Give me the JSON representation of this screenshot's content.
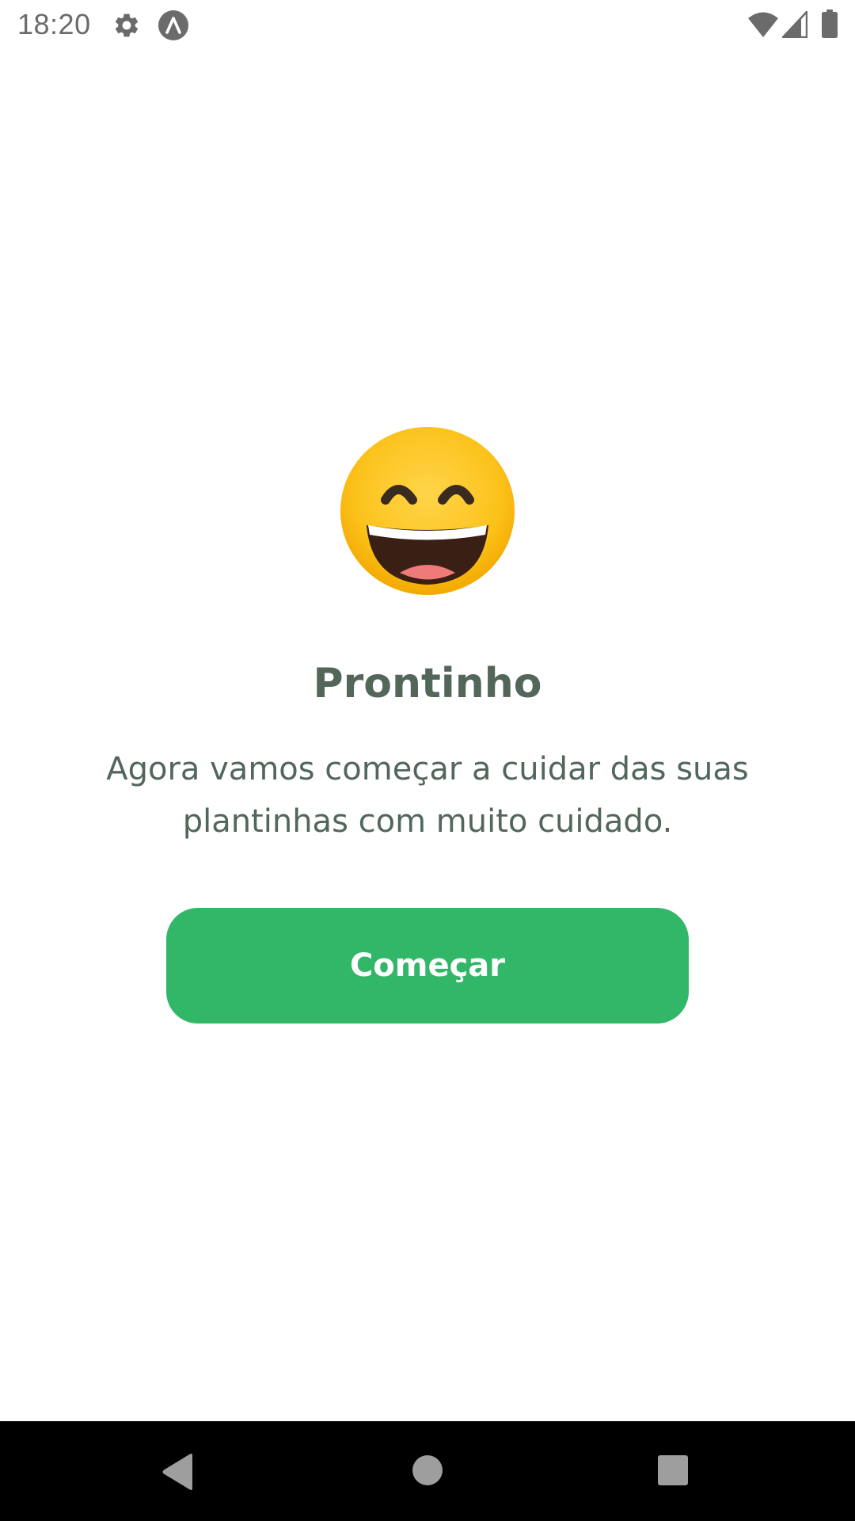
{
  "status_bar": {
    "time": "18:20",
    "icons": [
      "gear-icon",
      "app-notification-icon",
      "wifi-icon",
      "signal-icon",
      "battery-icon"
    ]
  },
  "main": {
    "emoji": "grinning-face-with-smiling-eyes",
    "title": "Prontinho",
    "subtitle": "Agora vamos começar a cuidar das suas plantinhas com muito cuidado.",
    "button_label": "Começar"
  },
  "nav_bar": {
    "icons": [
      "back-icon",
      "home-icon",
      "recents-icon"
    ]
  },
  "colors": {
    "accent": "#32b768",
    "heading": "#52665a",
    "background": "#ffffff",
    "nav_background": "#000000"
  }
}
